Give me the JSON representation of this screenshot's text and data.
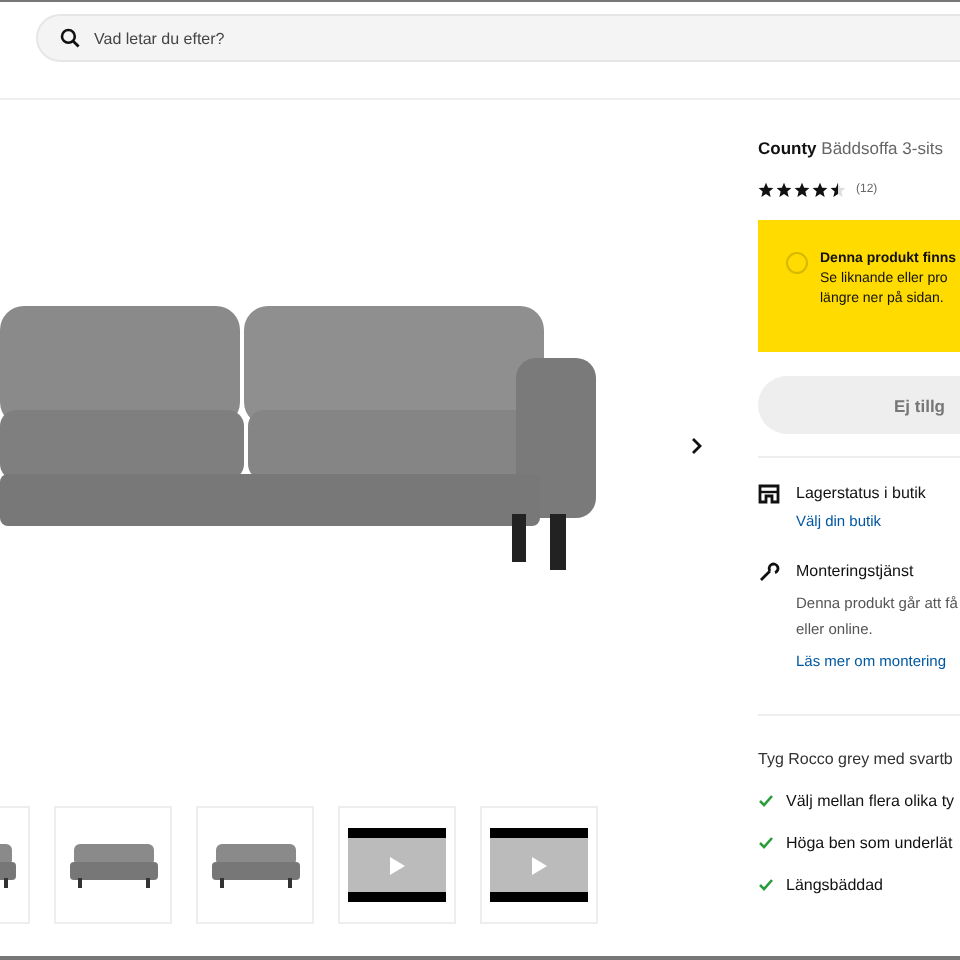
{
  "search": {
    "placeholder": "Vad letar du efter?"
  },
  "gallery": {
    "thumbnails": [
      {
        "kind": "image",
        "selected": false
      },
      {
        "kind": "image",
        "selected": false
      },
      {
        "kind": "image",
        "selected": false
      },
      {
        "kind": "video",
        "selected": false
      },
      {
        "kind": "video",
        "selected": false
      }
    ]
  },
  "product": {
    "brand": "County",
    "name": "Bäddsoffa 3-sits",
    "stars": 4.5,
    "rating_count": "(12)",
    "notice": {
      "title": "Denna produkt finns",
      "lines": [
        "Se liknande eller pro",
        "längre ner på sidan."
      ]
    },
    "button": {
      "label": "Ej tillg",
      "disabled": true
    },
    "services": [
      {
        "kind": "store",
        "title": "Lagerstatus i butik",
        "link": "Välj din butik"
      },
      {
        "kind": "assembly",
        "title": "Monteringstjänst",
        "description": "Denna produkt går att få\neller online.",
        "link": "Läs mer om montering"
      }
    ],
    "fabric": "Tyg Rocco grey med svartb",
    "features": [
      "Välj mellan flera olika ty",
      "Höga ben som underlät",
      "Längsbäddad"
    ]
  }
}
